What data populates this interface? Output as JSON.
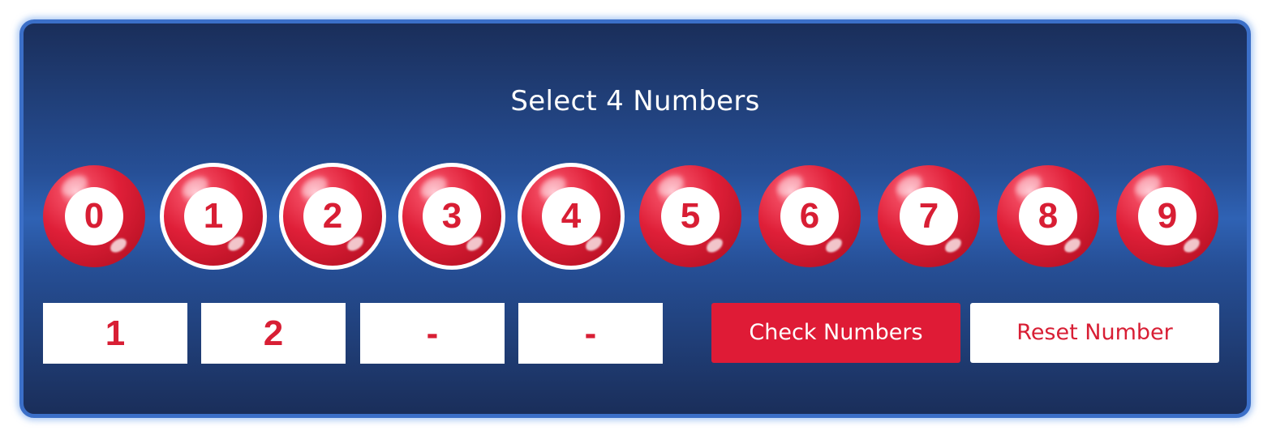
{
  "title": "Select 4 Numbers",
  "balls": [
    {
      "label": "0",
      "selected": false
    },
    {
      "label": "1",
      "selected": true
    },
    {
      "label": "2",
      "selected": true
    },
    {
      "label": "3",
      "selected": true
    },
    {
      "label": "4",
      "selected": true
    },
    {
      "label": "5",
      "selected": false
    },
    {
      "label": "6",
      "selected": false
    },
    {
      "label": "7",
      "selected": false
    },
    {
      "label": "8",
      "selected": false
    },
    {
      "label": "9",
      "selected": false
    }
  ],
  "slots": [
    "1",
    "2",
    "-",
    "-"
  ],
  "buttons": {
    "check_label": "Check Numbers",
    "reset_label": "Reset Number"
  },
  "colors": {
    "accent": "#df1b36",
    "panel_blue": "#264f96",
    "border_blue": "#3b6fc8"
  }
}
